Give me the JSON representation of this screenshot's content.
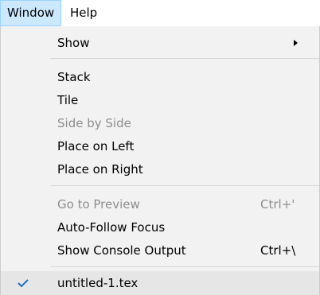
{
  "menubar": {
    "items": [
      {
        "label": "Window",
        "active": true
      },
      {
        "label": "Help",
        "active": false
      }
    ]
  },
  "window_menu": {
    "show": {
      "label": "Show",
      "has_submenu": true,
      "submenu_icon": "chevron-right-icon"
    },
    "stack": {
      "label": "Stack"
    },
    "tile": {
      "label": "Tile"
    },
    "side_by_side": {
      "label": "Side by Side",
      "disabled": true
    },
    "place_on_left": {
      "label": "Place on Left"
    },
    "place_on_right": {
      "label": "Place on Right"
    },
    "go_to_preview": {
      "label": "Go to Preview",
      "shortcut": "Ctrl+'",
      "disabled": true
    },
    "auto_follow_focus": {
      "label": "Auto-Follow Focus"
    },
    "show_console_output": {
      "label": "Show Console Output",
      "shortcut": "Ctrl+\\"
    },
    "document": {
      "label": "untitled-1.tex",
      "checked": true,
      "check_icon": "checkmark-icon"
    }
  },
  "colors": {
    "active_menubar_bg": "#cce8ff",
    "menu_bg": "#f2f2f2",
    "disabled_text": "#8d8d8d",
    "check_color": "#1e6fc5"
  }
}
